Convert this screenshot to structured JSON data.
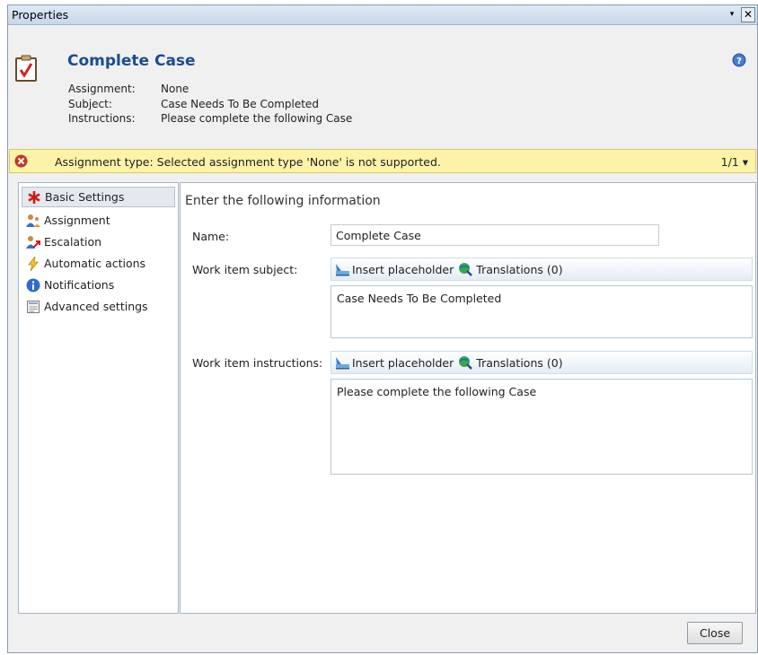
{
  "window": {
    "title": "Properties",
    "pin_glyph": "▾",
    "close_glyph": "✕"
  },
  "header": {
    "title": "Complete Case",
    "icon": "clipboard-check-icon",
    "assignment_label": "Assignment:",
    "assignment_value": "None",
    "subject_label": "Subject:",
    "subject_value": "Case Needs To Be Completed",
    "instructions_label": "Instructions:",
    "instructions_value": "Please complete the following Case"
  },
  "error_bar": {
    "message": "Assignment type: Selected assignment type 'None' is not supported.",
    "counter": "1/1 ▾",
    "color": "#fdf3a8"
  },
  "nav": {
    "items": [
      {
        "label": "Basic Settings",
        "icon": "red-asterisk-icon",
        "selected": true
      },
      {
        "label": "Assignment",
        "icon": "users-icon",
        "selected": false
      },
      {
        "label": "Escalation",
        "icon": "user-escalate-icon",
        "selected": false
      },
      {
        "label": "Automatic actions",
        "icon": "lightning-icon",
        "selected": false
      },
      {
        "label": "Notifications",
        "icon": "info-icon",
        "selected": false
      },
      {
        "label": "Advanced settings",
        "icon": "settings-form-icon",
        "selected": false
      }
    ]
  },
  "main": {
    "section_title": "Enter the following information",
    "name_label": "Name:",
    "name_value": "Complete Case",
    "subject_label": "Work item subject:",
    "subject_value": "Case Needs To Be Completed",
    "instructions_label": "Work item instructions:",
    "instructions_value": "Please complete the following Case",
    "insert_placeholder": "Insert placeholder",
    "translations": "Translations (0)"
  },
  "footer": {
    "close_label": "Close"
  },
  "colors": {
    "accent": "#1d4b8f",
    "titlebar": "#c7d7ea",
    "error_icon": "#c0392b"
  }
}
